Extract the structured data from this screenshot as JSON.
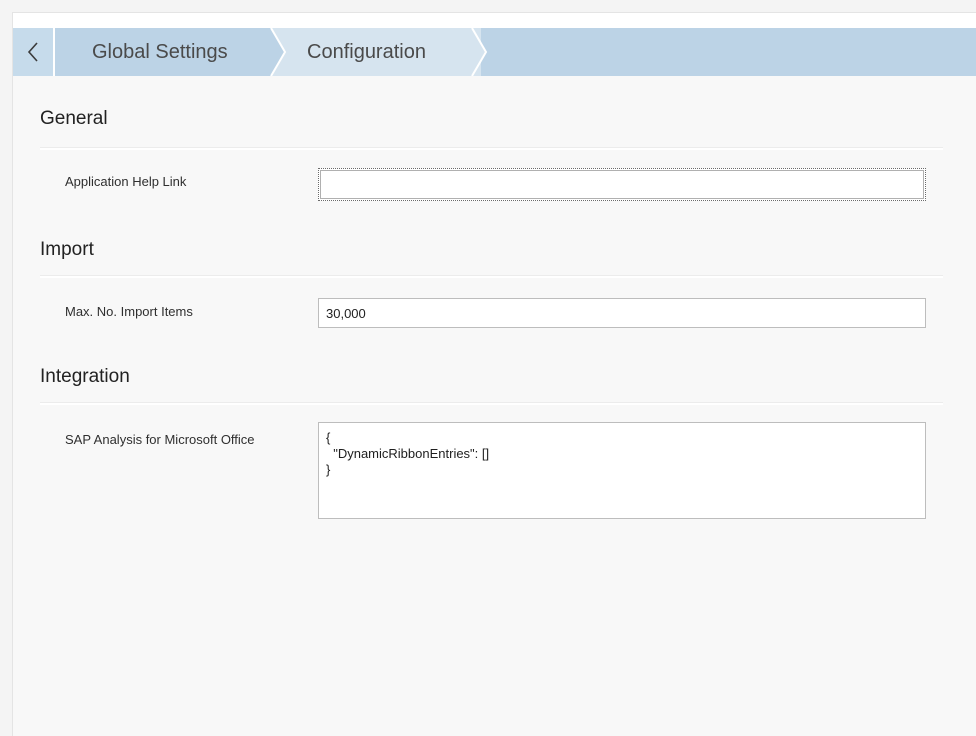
{
  "breadcrumb": {
    "items": [
      {
        "label": "Global Settings"
      },
      {
        "label": "Configuration"
      }
    ]
  },
  "sections": {
    "general": {
      "title": "General",
      "help_link": {
        "label": "Application Help Link",
        "value": ""
      }
    },
    "import": {
      "title": "Import",
      "max_items": {
        "label": "Max. No. Import Items",
        "value": "30,000"
      }
    },
    "integration": {
      "title": "Integration",
      "sap_analysis": {
        "label": "SAP Analysis for Microsoft Office",
        "value": "{\n  \"DynamicRibbonEntries\": []\n}"
      }
    }
  },
  "colors": {
    "breadcrumb_bg": "#bcd3e6",
    "breadcrumb_active": "#d6e4ef",
    "panel_bg": "#f8f8f8"
  },
  "icons": {
    "back": "chevron-left-icon"
  }
}
